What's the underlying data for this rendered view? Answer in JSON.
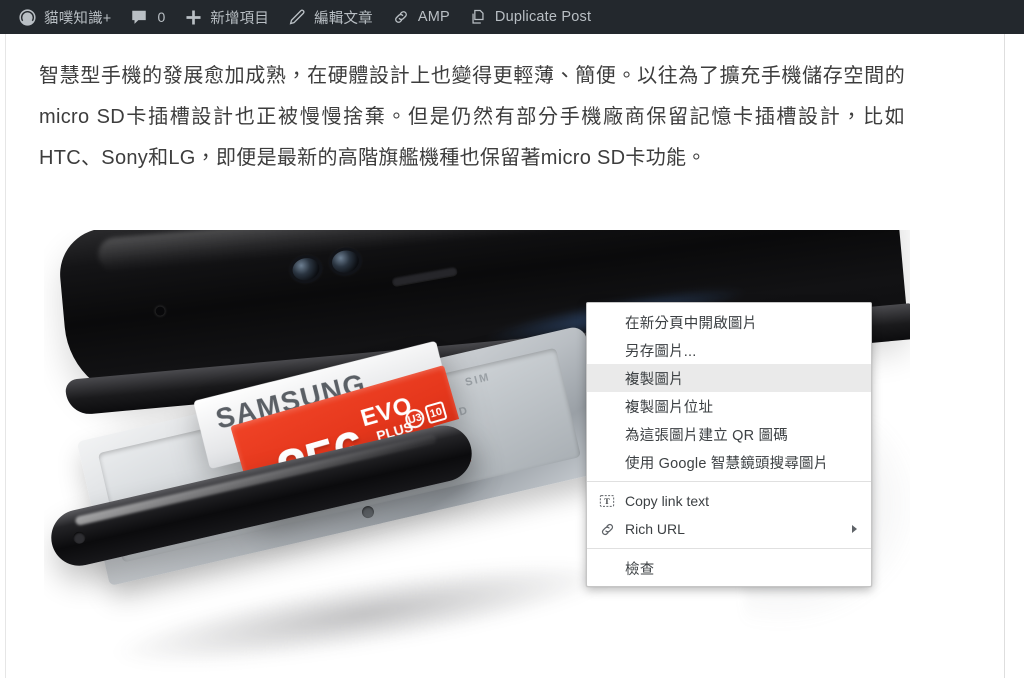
{
  "adminbar": {
    "items": [
      {
        "icon": "dashboard-gauge-icon",
        "label": "貓噗知識+",
        "count": null
      },
      {
        "icon": "comment-bubble-icon",
        "label": "",
        "count": "0"
      },
      {
        "icon": "plus-icon",
        "label": "新增項目",
        "count": null
      },
      {
        "icon": "pencil-icon",
        "label": "編輯文章",
        "count": null
      },
      {
        "icon": "link-chain-icon",
        "label": "AMP",
        "count": null
      },
      {
        "icon": "duplicate-pages-icon",
        "label": "Duplicate Post",
        "count": null
      }
    ],
    "background_color": "#23282d",
    "text_color": "#b9bfc4"
  },
  "article": {
    "paragraph": "智慧型手機的發展愈加成熟，在硬體設計上也變得更輕薄、簡便。以往為了擴充手機儲存空間的micro SD卡插槽設計也正被慢慢捨棄。但是仍然有部分手機廠商保留記憶卡插槽設計，比如HTC、Sony和LG，即便是最新的高階旗艦機種也保留著micro SD卡功能。"
  },
  "photo": {
    "alt_description": "智慧型手機的 SIM / microSD 卡插槽托盤與記憶卡",
    "sd_card": {
      "brand": "SAMSUNG",
      "capacity": "256",
      "line": "EVO",
      "sub": "PLUS",
      "badge_speed": "U3",
      "badge_class": "10"
    },
    "tray_labels": {
      "sim": "SIM",
      "microsd": "microSD"
    }
  },
  "context_menu": {
    "groups": [
      {
        "items": [
          {
            "label": "在新分頁中開啟圖片",
            "icon": null,
            "highlight": false,
            "submenu": false,
            "lang": "zh"
          },
          {
            "label": "另存圖片...",
            "icon": null,
            "highlight": false,
            "submenu": false,
            "lang": "zh"
          },
          {
            "label": "複製圖片",
            "icon": null,
            "highlight": true,
            "submenu": false,
            "lang": "zh"
          },
          {
            "label": "複製圖片位址",
            "icon": null,
            "highlight": false,
            "submenu": false,
            "lang": "zh"
          },
          {
            "label": "為這張圖片建立 QR 圖碼",
            "icon": null,
            "highlight": false,
            "submenu": false,
            "lang": "zh"
          },
          {
            "label": "使用 Google 智慧鏡頭搜尋圖片",
            "icon": null,
            "highlight": false,
            "submenu": false,
            "lang": "zh"
          }
        ]
      },
      {
        "items": [
          {
            "label": "Copy link text",
            "icon": "text-box-icon",
            "highlight": false,
            "submenu": false,
            "lang": "en"
          },
          {
            "label": "Rich URL",
            "icon": "link-chain-icon",
            "highlight": false,
            "submenu": true,
            "lang": "en"
          }
        ]
      },
      {
        "items": [
          {
            "label": "檢查",
            "icon": null,
            "highlight": false,
            "submenu": false,
            "lang": "zh"
          }
        ]
      }
    ],
    "highlight_color": "#eaeaea",
    "background_color": "#ffffff"
  }
}
